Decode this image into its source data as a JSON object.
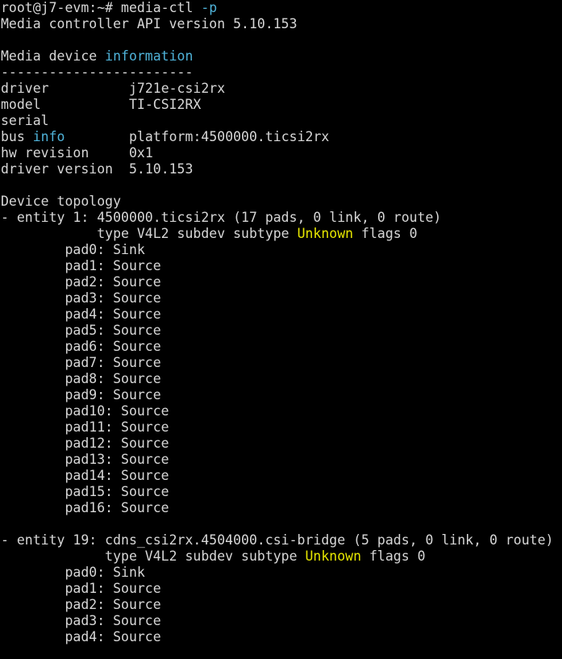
{
  "colors": {
    "background": "#000000",
    "foreground": "#d6d6d6",
    "keyword_blue": "#4fb3d9",
    "keyword_yellow": "#e6e600"
  },
  "prompt": {
    "user_host": "root@j7-evm:~#",
    "command": "media-ctl",
    "flag": "-p"
  },
  "api_version_line": "Media controller API version 5.10.153",
  "device_info": {
    "heading_prefix": "Media device ",
    "heading_keyword": "information",
    "separator": "------------------------",
    "rows": [
      {
        "label": "driver          ",
        "label_keyword": "",
        "label_suffix": "",
        "value": "j721e-csi2rx"
      },
      {
        "label": "model           ",
        "label_keyword": "",
        "label_suffix": "",
        "value": "TI-CSI2RX"
      },
      {
        "label": "serial",
        "label_keyword": "",
        "label_suffix": "",
        "value": ""
      },
      {
        "label": "bus ",
        "label_keyword": "info",
        "label_suffix": "        ",
        "value": "platform:4500000.ticsi2rx"
      },
      {
        "label": "hw revision     ",
        "label_keyword": "",
        "label_suffix": "",
        "value": "0x1"
      },
      {
        "label": "driver version  ",
        "label_keyword": "",
        "label_suffix": "",
        "value": "5.10.153"
      }
    ]
  },
  "topology": {
    "heading": "Device topology",
    "entities": [
      {
        "header": "- entity 1: 4500000.ticsi2rx (17 pads, 0 link, 0 route)",
        "type_prefix": "            type V4L2 subdev subtype ",
        "subtype": "Unknown",
        "flags": " flags 0",
        "pads": [
          "pad0: Sink",
          "pad1: Source",
          "pad2: Source",
          "pad3: Source",
          "pad4: Source",
          "pad5: Source",
          "pad6: Source",
          "pad7: Source",
          "pad8: Source",
          "pad9: Source",
          "pad10: Source",
          "pad11: Source",
          "pad12: Source",
          "pad13: Source",
          "pad14: Source",
          "pad15: Source",
          "pad16: Source"
        ]
      },
      {
        "header": "- entity 19: cdns_csi2rx.4504000.csi-bridge (5 pads, 0 link, 0 route)",
        "type_prefix": "             type V4L2 subdev subtype ",
        "subtype": "Unknown",
        "flags": " flags 0",
        "pads": [
          "pad0: Sink",
          "pad1: Source",
          "pad2: Source",
          "pad3: Source",
          "pad4: Source"
        ]
      }
    ]
  }
}
